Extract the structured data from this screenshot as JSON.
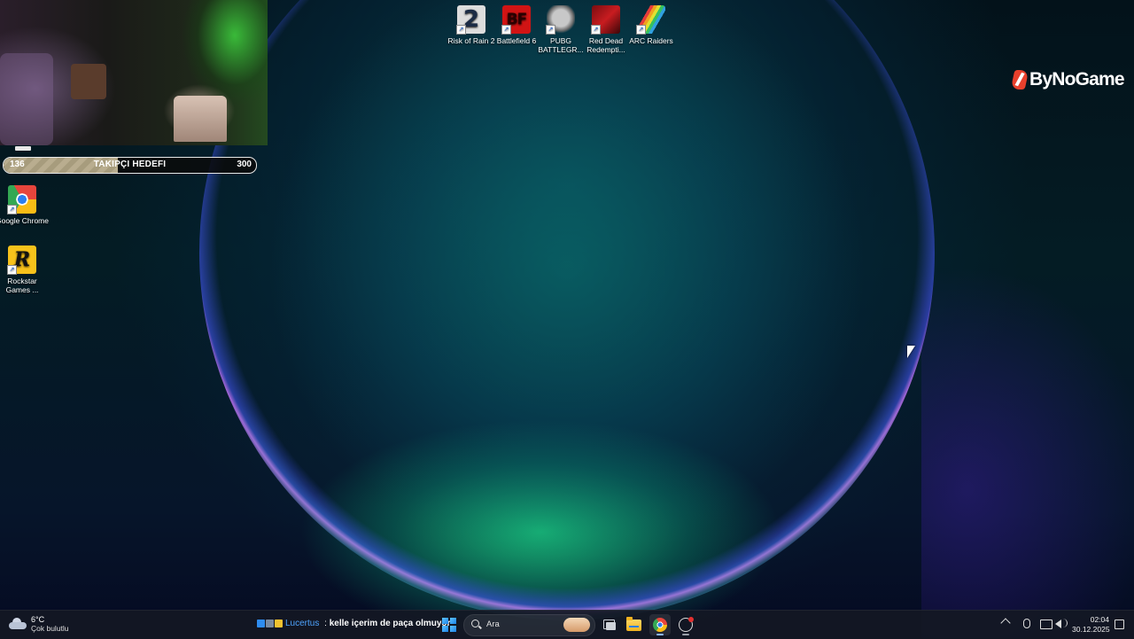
{
  "stream_overlay": {
    "follower_goal": {
      "current": "136",
      "title": "TAKIPÇI HEDEFI",
      "target": "300",
      "progress_fraction": 0.453
    },
    "logo_text": "ByNoGame"
  },
  "desktop": {
    "top_icons": [
      {
        "label": "Risk of Rain 2",
        "icon": "risk-of-rain-2-icon",
        "glyph": "2"
      },
      {
        "label": "Battlefield 6",
        "icon": "battlefield-6-icon",
        "glyph": "BF"
      },
      {
        "label": "PUBG BATTLEGR...",
        "icon": "pubg-icon",
        "glyph": ""
      },
      {
        "label": "Red Dead Redempti...",
        "icon": "red-dead-redemption-icon",
        "glyph": ""
      },
      {
        "label": "ARC Raiders",
        "icon": "arc-raiders-icon",
        "glyph": ""
      }
    ],
    "left_icons": [
      {
        "label": "Google Chrome",
        "icon": "chrome-icon",
        "glyph": ""
      },
      {
        "label": "Rockstar Games ...",
        "icon": "rockstar-games-icon",
        "glyph": "R"
      }
    ]
  },
  "taskbar": {
    "weather": {
      "temp": "6°C",
      "condition": "Çok bulutlu"
    },
    "chat": {
      "username": "Lucertus",
      "separator": " : ",
      "message": "kelle içerim de paça olmuyor"
    },
    "search_placeholder": "Ara",
    "clock": {
      "time": "02:04",
      "date": "30.12.2025"
    }
  },
  "colors": {
    "accent": "#2d7ff0",
    "chat_username": "#4ea4ff",
    "logo_red": "#e8402c",
    "goal_fill": "#b9ad8f"
  }
}
